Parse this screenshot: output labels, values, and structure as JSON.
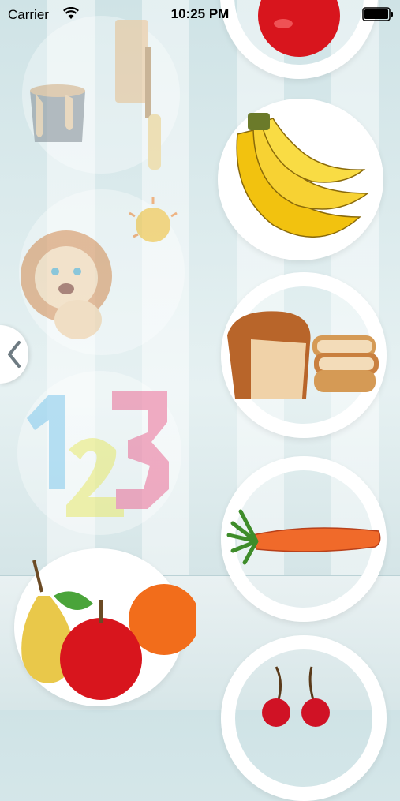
{
  "status_bar": {
    "carrier": "Carrier",
    "time": "10:25 PM"
  },
  "categories_left": [
    {
      "name": "colors",
      "icon": "paint-bucket-roller-icon"
    },
    {
      "name": "animals",
      "icon": "lion-icon"
    },
    {
      "name": "numbers",
      "icon": "numbers-123-icon",
      "label": "123"
    },
    {
      "name": "fruits",
      "icon": "fruits-icon"
    }
  ],
  "items_right": [
    {
      "name": "apple",
      "icon": "apple-icon"
    },
    {
      "name": "banana",
      "icon": "banana-icon"
    },
    {
      "name": "bread",
      "icon": "bread-icon"
    },
    {
      "name": "carrot",
      "icon": "carrot-icon"
    },
    {
      "name": "cherries",
      "icon": "cherries-icon"
    }
  ],
  "colors": {
    "apple": "#d8151d",
    "banana": "#f2c20f",
    "bread": "#c9803f",
    "carrot": "#f06a2a",
    "leaf": "#3e8c2a"
  }
}
